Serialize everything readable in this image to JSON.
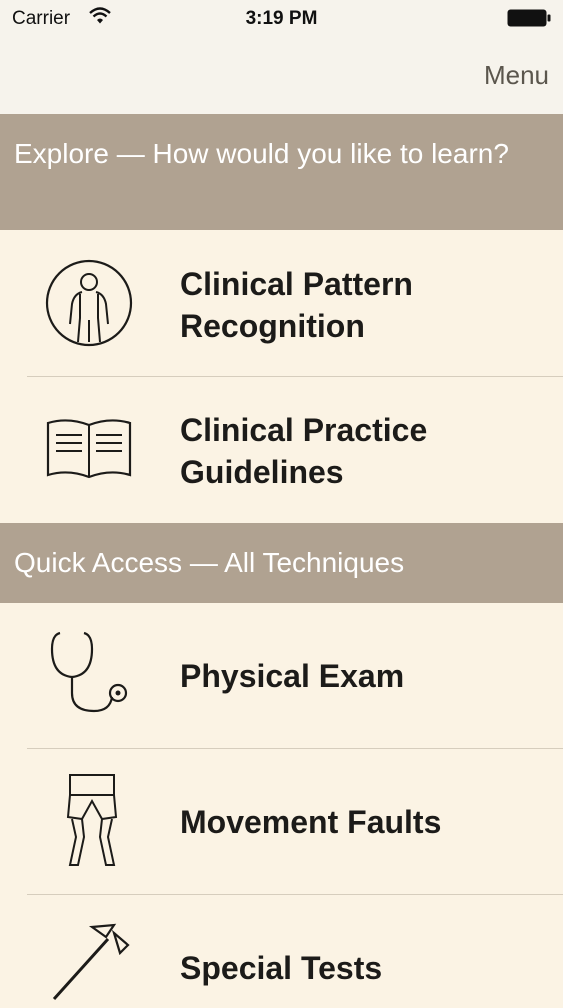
{
  "status_bar": {
    "carrier": "Carrier",
    "time": "3:19 PM",
    "icons": [
      "wifi-icon",
      "battery-icon"
    ]
  },
  "navbar": {
    "menu_label": "Menu"
  },
  "explore": {
    "header": "Explore — How would you like to learn?",
    "items": [
      {
        "label_line1": "Clinical Pattern",
        "label_line2": "Recognition",
        "icon": "human-body-icon"
      },
      {
        "label_line1": "Clinical Practice",
        "label_line2": "Guidelines",
        "icon": "open-book-icon"
      }
    ]
  },
  "quick_access": {
    "header": "Quick Access — All Techniques",
    "items": [
      {
        "label": "Physical Exam",
        "icon": "stethoscope-icon"
      },
      {
        "label": "Movement Faults",
        "icon": "legs-icon"
      },
      {
        "label": "Special Tests",
        "icon": "reflex-hammer-icon"
      }
    ]
  },
  "colors": {
    "background": "#fbf3e4",
    "section_header": "#b0a291",
    "navbar": "#f6f3ec",
    "text": "#1c1b19"
  }
}
